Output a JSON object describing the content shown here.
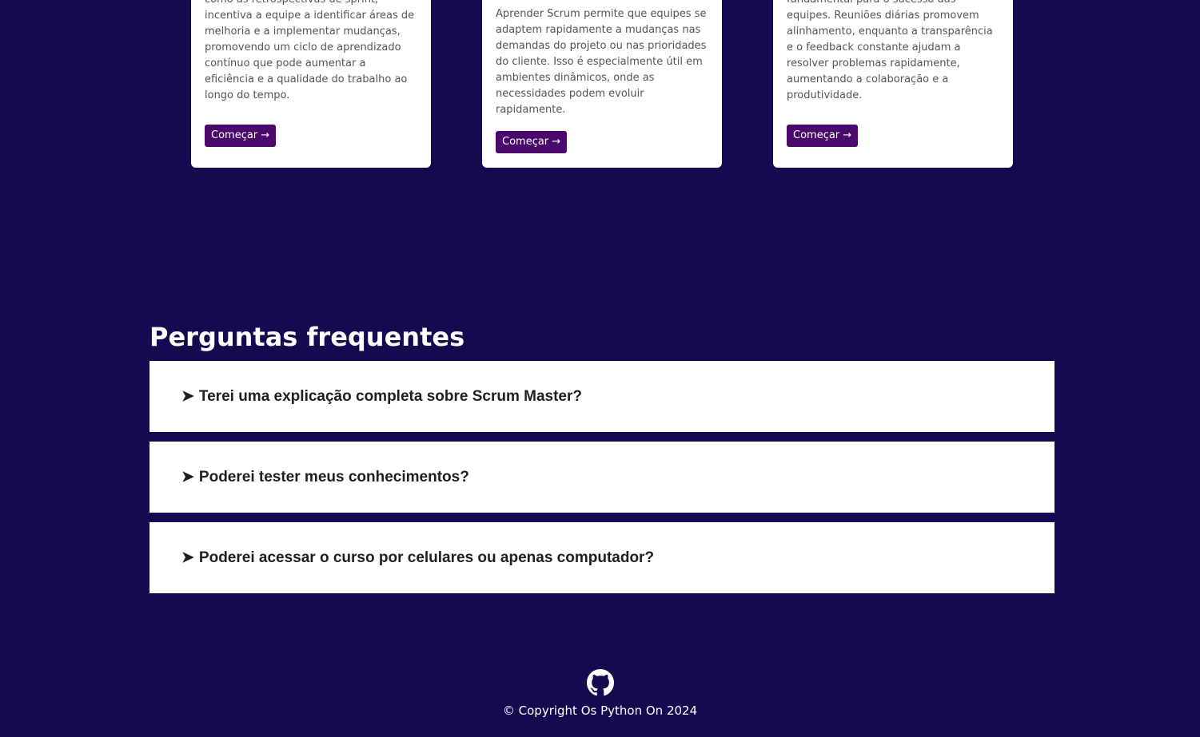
{
  "cards": [
    {
      "text": "como as retrospectivas de sprint, incentiva a equipe a identificar áreas de melhoria e a implementar mudanças, promovendo um ciclo de aprendizado contínuo que pode aumentar a eficiência e a qualidade do trabalho ao longo do tempo.",
      "button": "Começar →"
    },
    {
      "text": "Aprender Scrum permite que equipes se adaptem rapidamente a mudanças nas demandas do projeto ou nas prioridades do cliente. Isso é especialmente útil em ambientes dinâmicos, onde as necessidades podem evoluir rapidamente.",
      "button": "Começar →"
    },
    {
      "text": "fundamental para o sucesso das equipes. Reuniões diárias promovem alinhamento, enquanto a transparência e o feedback constante ajudam a resolver problemas rapidamente, aumentando a colaboração e a produtividade.",
      "button": "Começar →"
    }
  ],
  "faq": {
    "title": "Perguntas frequentes",
    "arrow": "➤",
    "items": [
      "Terei uma explicação completa sobre Scrum Master?",
      "Poderei tester meus conhecimentos?",
      "Poderei acessar o curso por celulares ou apenas computador?"
    ]
  },
  "footer": {
    "icon": "github-icon",
    "copyright": "© Copyright Os Python On 2024"
  },
  "colors": {
    "background": "#140a50",
    "button": "#4b0a6b",
    "card": "#ffffff"
  }
}
